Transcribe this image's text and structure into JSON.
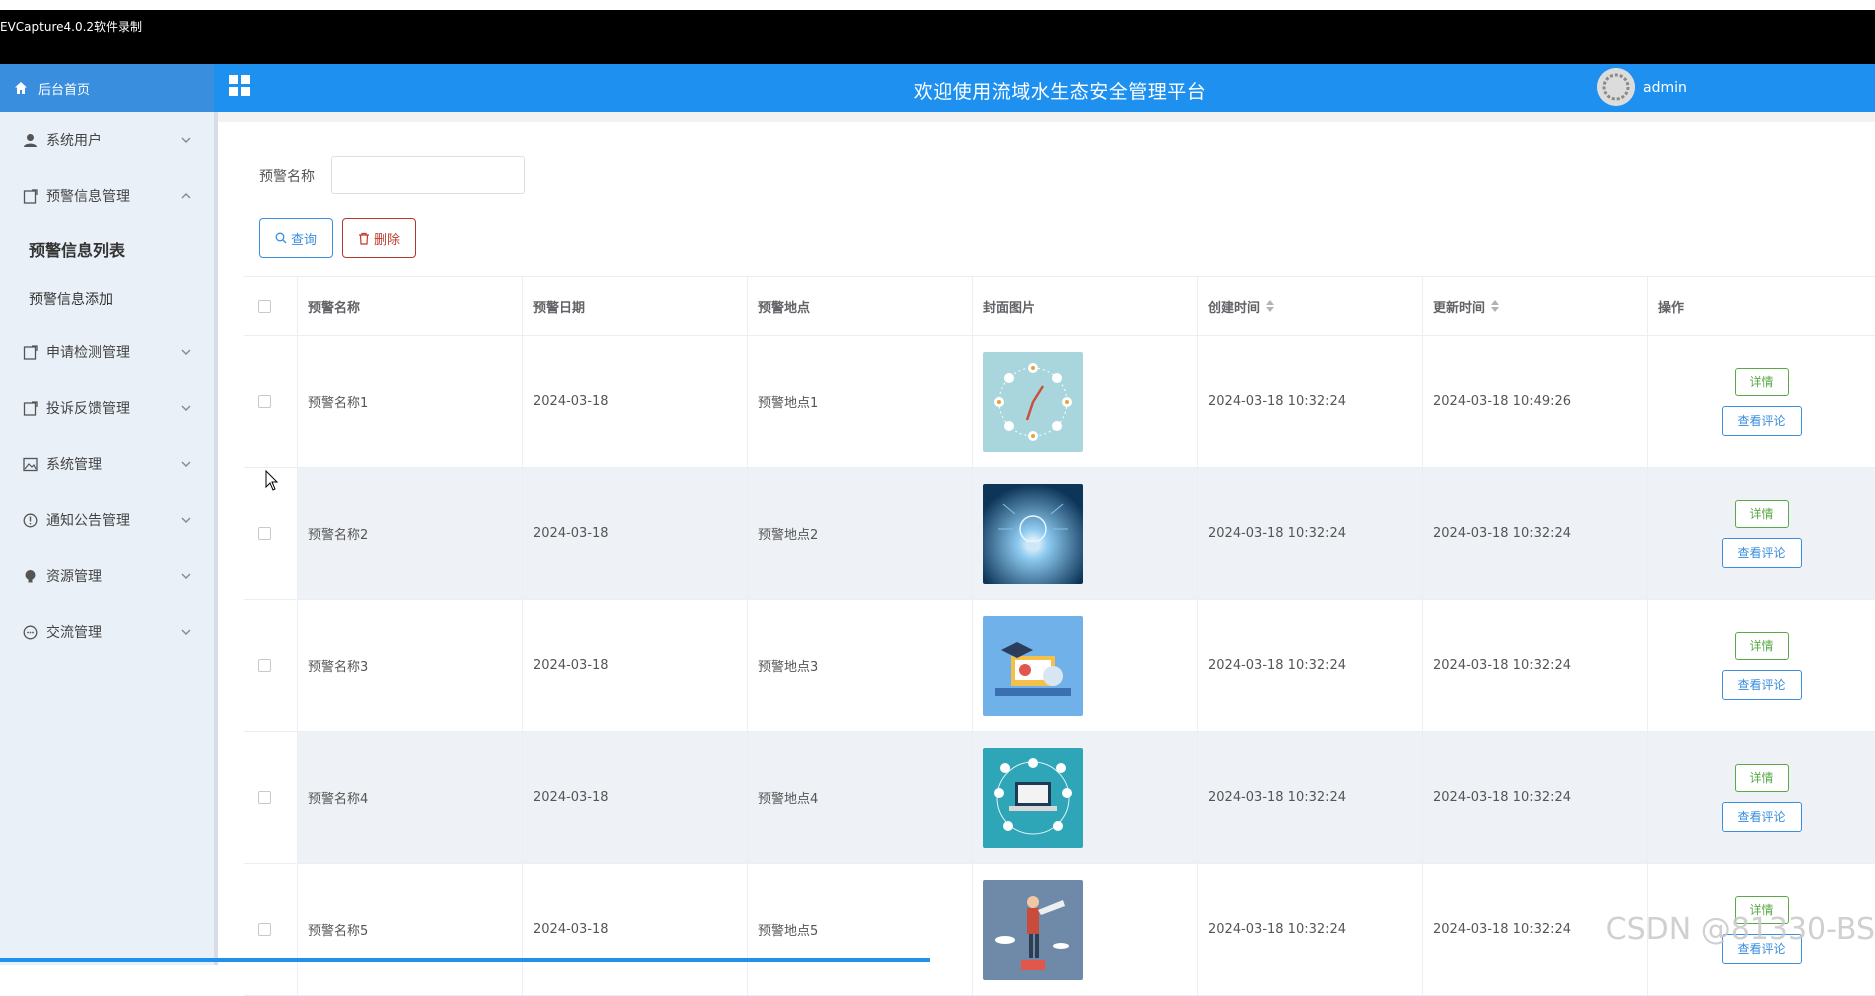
{
  "recorder": {
    "title": "EVCapture4.0.2软件录制"
  },
  "header": {
    "home_label": "后台首页",
    "title": "欢迎使用流域水生态安全管理平台",
    "username": "admin"
  },
  "sidebar": {
    "items": [
      {
        "label": "系统用户",
        "icon": "user-icon"
      },
      {
        "label": "预警信息管理",
        "icon": "document-icon",
        "expanded": true
      },
      {
        "label": "申请检测管理",
        "icon": "document-icon"
      },
      {
        "label": "投诉反馈管理",
        "icon": "document-icon"
      },
      {
        "label": "系统管理",
        "icon": "image-icon"
      },
      {
        "label": "通知公告管理",
        "icon": "info-icon"
      },
      {
        "label": "资源管理",
        "icon": "lightbulb-icon"
      },
      {
        "label": "交流管理",
        "icon": "chat-icon"
      }
    ],
    "subitems": [
      {
        "label": "预警信息列表",
        "active": true
      },
      {
        "label": "预警信息添加"
      }
    ]
  },
  "search": {
    "label": "预警名称",
    "value": "",
    "search_button": "查询",
    "delete_button": "删除"
  },
  "table": {
    "columns": [
      "预警名称",
      "预警日期",
      "预警地点",
      "封面图片",
      "创建时间",
      "更新时间",
      "操作"
    ],
    "rows": [
      {
        "name": "预警名称1",
        "date": "2024-03-18",
        "place": "预警地点1",
        "created": "2024-03-18 10:32:24",
        "updated": "2024-03-18 10:49:26"
      },
      {
        "name": "预警名称2",
        "date": "2024-03-18",
        "place": "预警地点2",
        "created": "2024-03-18 10:32:24",
        "updated": "2024-03-18 10:32:24"
      },
      {
        "name": "预警名称3",
        "date": "2024-03-18",
        "place": "预警地点3",
        "created": "2024-03-18 10:32:24",
        "updated": "2024-03-18 10:32:24"
      },
      {
        "name": "预警名称4",
        "date": "2024-03-18",
        "place": "预警地点4",
        "created": "2024-03-18 10:32:24",
        "updated": "2024-03-18 10:32:24"
      },
      {
        "name": "预警名称5",
        "date": "2024-03-18",
        "place": "预警地点5",
        "created": "2024-03-18 10:32:24",
        "updated": "2024-03-18 10:32:24"
      }
    ],
    "detail_button": "详情",
    "comment_button": "查看评论"
  },
  "watermark": "CSDN @81330-BS",
  "colors": {
    "header": "#1e90f0",
    "sidebar": "#e9f0f7",
    "primary": "#3a8ede",
    "danger": "#c0392b",
    "success": "#5aa848"
  }
}
